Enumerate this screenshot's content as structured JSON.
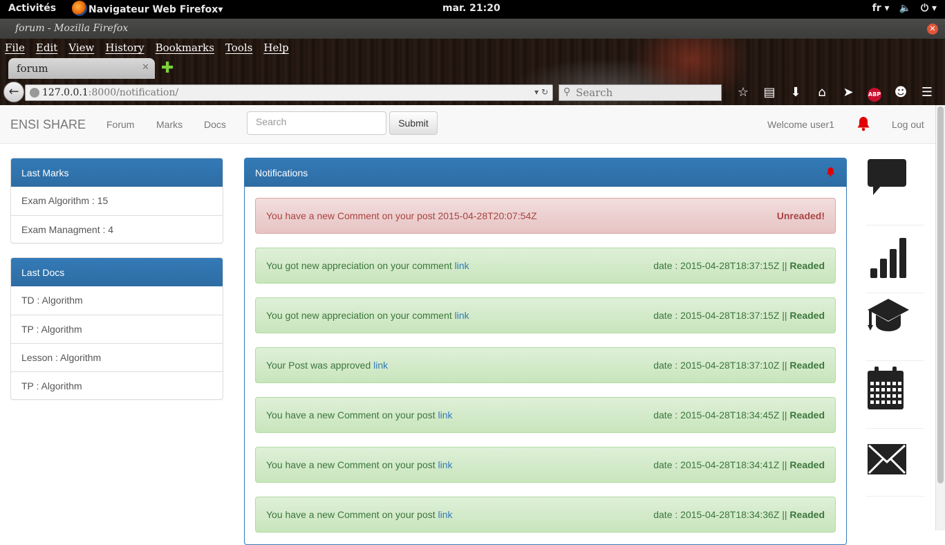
{
  "os": {
    "activities": "Activités",
    "app_menu": "Navigateur Web Firefox",
    "clock": "mar. 21:20",
    "lang": "fr"
  },
  "browser": {
    "window_title": "forum - Mozilla Firefox",
    "menu": [
      "File",
      "Edit",
      "View",
      "History",
      "Bookmarks",
      "Tools",
      "Help"
    ],
    "tab_label": "forum",
    "url_host": "127.0.0.1",
    "url_rest": ":8000/notification/",
    "search_placeholder": "Search",
    "abp": "ABP"
  },
  "navbar": {
    "brand": "ENSI SHARE",
    "links": [
      "Forum",
      "Marks",
      "Docs"
    ],
    "search_placeholder": "Search",
    "submit": "Submit",
    "welcome": "Welcome user1",
    "logout": "Log out"
  },
  "last_marks": {
    "title": "Last Marks",
    "items": [
      "Exam Algorithm : 15",
      "Exam Managment : 4"
    ]
  },
  "last_docs": {
    "title": "Last Docs",
    "items": [
      "TD : Algorithm",
      "TP : Algorithm",
      "Lesson : Algorithm",
      "TP : Algorithm"
    ]
  },
  "notifications": {
    "title": "Notifications",
    "items": [
      {
        "text": "You have a new Comment on your post 2015-04-28T20:07:54Z",
        "link": "",
        "date": "",
        "status": "Unreaded!"
      },
      {
        "text": "You got new appreciation on your comment",
        "link": "link",
        "date": "date : 2015-04-28T18:37:15Z ||",
        "status": "Readed"
      },
      {
        "text": "You got new appreciation on your comment",
        "link": "link",
        "date": "date : 2015-04-28T18:37:15Z ||",
        "status": "Readed"
      },
      {
        "text": "Your Post was approved",
        "link": "link",
        "date": "date : 2015-04-28T18:37:10Z ||",
        "status": "Readed"
      },
      {
        "text": "You have a new Comment on your post",
        "link": "link",
        "date": "date : 2015-04-28T18:34:45Z ||",
        "status": "Readed"
      },
      {
        "text": "You have a new Comment on your post",
        "link": "link",
        "date": "date : 2015-04-28T18:34:41Z ||",
        "status": "Readed"
      },
      {
        "text": "You have a new Comment on your post",
        "link": "link",
        "date": "date : 2015-04-28T18:34:36Z ||",
        "status": "Readed"
      }
    ]
  },
  "sidebar_icons": [
    "chat-icon",
    "signal-bars-icon",
    "graduation-cap-icon",
    "calendar-icon",
    "envelope-icon"
  ],
  "colors": {
    "primary": "#337ab7",
    "danger_text": "#a94442",
    "success_text": "#3c763d",
    "bell": "#e00000"
  }
}
